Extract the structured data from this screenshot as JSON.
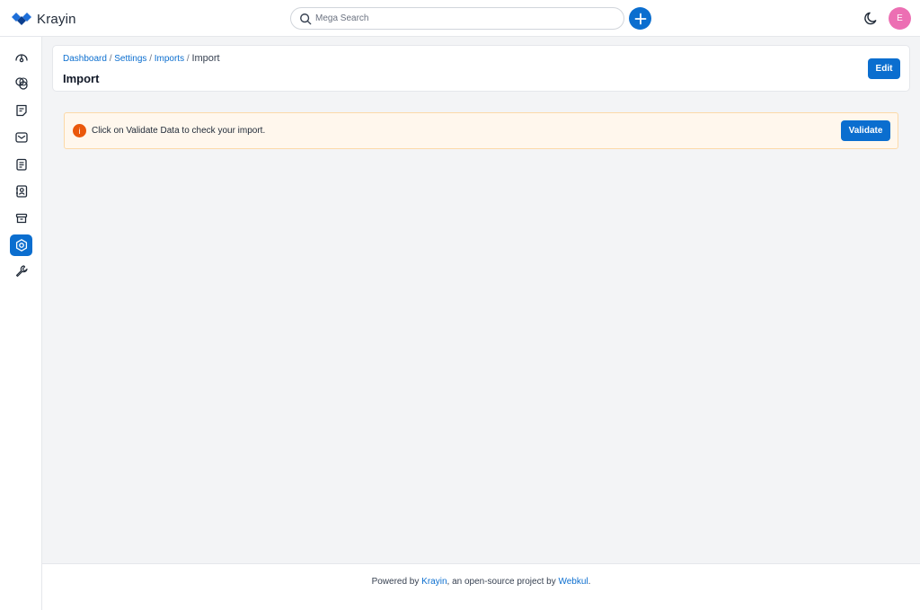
{
  "app": {
    "name": "Krayin",
    "brand_color": "#0b6ecf"
  },
  "search": {
    "placeholder": "Mega Search"
  },
  "user": {
    "initial": "E",
    "avatar_color": "#ec6fb3"
  },
  "sidebar": {
    "items": [
      {
        "name": "dashboard",
        "icon": "gauge-icon",
        "active": false
      },
      {
        "name": "leads",
        "icon": "filter-icon",
        "active": false
      },
      {
        "name": "quotes",
        "icon": "note-icon",
        "active": false
      },
      {
        "name": "mail",
        "icon": "mail-icon",
        "active": false
      },
      {
        "name": "activities",
        "icon": "list-icon",
        "active": false
      },
      {
        "name": "contacts",
        "icon": "contact-book-icon",
        "active": false
      },
      {
        "name": "products",
        "icon": "box-icon",
        "active": false
      },
      {
        "name": "settings",
        "icon": "gear-icon",
        "active": true
      },
      {
        "name": "configuration",
        "icon": "wrench-icon",
        "active": false
      }
    ]
  },
  "breadcrumb": {
    "items": [
      "Dashboard",
      "Settings",
      "Imports"
    ],
    "current": "Import",
    "separator": "/"
  },
  "page": {
    "title": "Import",
    "edit_label": "Edit"
  },
  "alert": {
    "icon_label": "i",
    "message": "Click on Validate Data to check your import.",
    "button_label": "Validate"
  },
  "footer": {
    "prefix": "Powered by ",
    "link1": "Krayin",
    "middle": ", an open-source project by ",
    "link2": "Webkul",
    "suffix": "."
  }
}
